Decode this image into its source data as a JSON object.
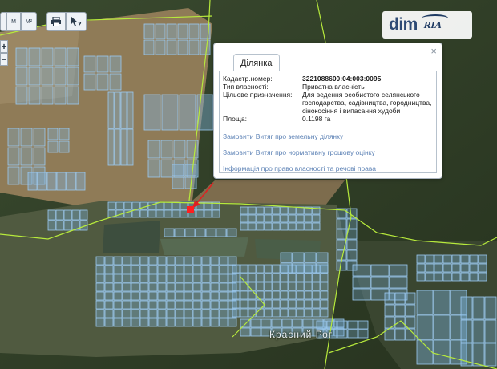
{
  "map": {
    "village_label": "Красний Рог",
    "parcel_fill": "#7fb6e6",
    "parcel_stroke": "#9ccaf2",
    "road_color": "#b7ea3c",
    "marker_color": "#ff1f1f"
  },
  "toolbar": {
    "measure_label": "M",
    "area_label": "M²"
  },
  "logo": {
    "dim": "dim",
    "ria": "RIA"
  },
  "popup": {
    "tab": "Ділянка",
    "close": "×",
    "rows": [
      {
        "label": "Кадастр.номер:",
        "value": "3221088600:04:003:0095"
      },
      {
        "label": "Тип власності:",
        "value": "Приватна власність"
      },
      {
        "label": "Цільове призначення:",
        "value": "Для ведення особистого селянського господарства, садівництва, городництва, сінокосіння і випасання худоби"
      },
      {
        "label": "Площа:",
        "value": "0.1198 га"
      }
    ],
    "links": [
      "Замовити Витяг про земельну ділянку",
      "Замовити Витяг про нормативну грошову оцінку",
      "Інформація про право власності та речові права"
    ]
  }
}
